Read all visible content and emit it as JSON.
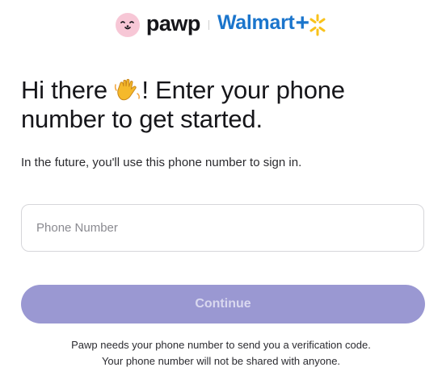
{
  "brand": {
    "pawp_name": "pawp",
    "partner_name": "Walmart",
    "partner_suffix": "+",
    "pawp_color": "#f7c7d6",
    "walmart_blue": "#1b75cc",
    "walmart_spark": "#f9c21a",
    "pawp_icon": "pawp-face-icon",
    "spark_icon": "walmart-spark-icon"
  },
  "headline": {
    "part1": "Hi there ",
    "emoji_icon": "waving-hand-icon",
    "part2": "! Enter your phone number to get started."
  },
  "subtext": "In the future, you'll use this phone number to sign in.",
  "phone_input": {
    "placeholder": "Phone Number",
    "value": ""
  },
  "continue_button": {
    "label": "Continue",
    "enabled": false,
    "color": "#9a98d2"
  },
  "notice": {
    "line1": "Pawp needs your phone number to send you a verification code.",
    "line2": "Your phone number will not be shared with anyone."
  }
}
